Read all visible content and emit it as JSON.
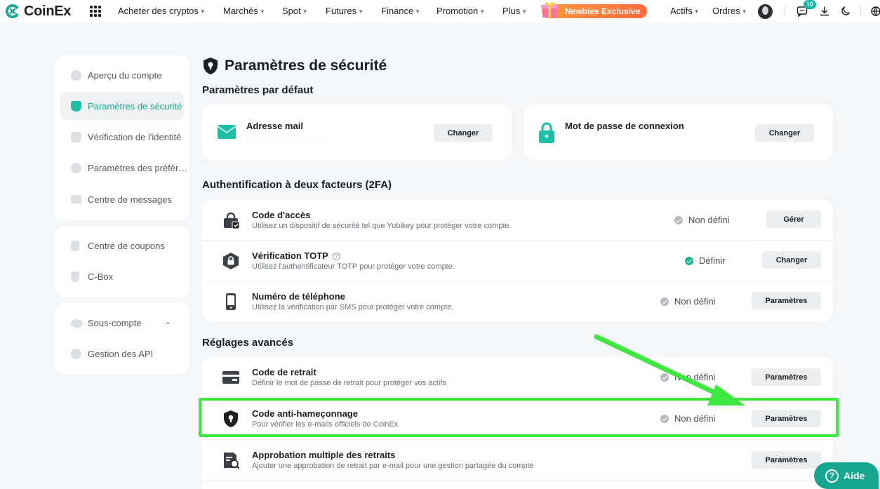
{
  "brand": {
    "name": "CoinEx",
    "accent": "#14a68f"
  },
  "nav": {
    "items": [
      "Acheter des cryptos",
      "Marchés",
      "Spot",
      "Futures",
      "Finance",
      "Promotion",
      "Plus"
    ],
    "promo_label": "Newbies Exclusive",
    "right_items": [
      "Actifs",
      "Ordres"
    ],
    "notification_count": "10"
  },
  "sidebar": {
    "group1": [
      {
        "label": "Aperçu du compte",
        "icon": "pie-chart-icon"
      },
      {
        "label": "Paramètres de sécurité",
        "icon": "shield-icon",
        "active": true
      },
      {
        "label": "Vérification de l'identité",
        "icon": "id-check-icon"
      },
      {
        "label": "Paramètres des préfér…",
        "icon": "preferences-icon"
      },
      {
        "label": "Centre de messages",
        "icon": "message-icon"
      }
    ],
    "group2": [
      {
        "label": "Centre de coupons",
        "icon": "coupon-icon"
      },
      {
        "label": "C-Box",
        "icon": "cbox-icon"
      }
    ],
    "group3": [
      {
        "label": "Sous-compte",
        "icon": "subaccount-icon"
      },
      {
        "label": "Gestion des API",
        "icon": "api-icon"
      }
    ]
  },
  "page": {
    "title": "Paramètres de sécurité",
    "default_section": {
      "title": "Paramètres par défaut",
      "email": {
        "title": "Adresse mail",
        "masked_value": "· · · · · · · · · · ·  · ·",
        "button": "Changer"
      },
      "password": {
        "title": "Mot de passe de connexion",
        "button": "Changer"
      }
    },
    "twofa_section": {
      "title": "Authentification à deux facteurs (2FA)",
      "rows": [
        {
          "title": "Code d'accès",
          "desc": "Utilisez un dispositif de sécurité tel que Yubikey pour protéger votre compte.",
          "status": "Non défini",
          "button": "Gérer"
        },
        {
          "title": "Vérification TOTP",
          "desc": "Utilisez l'authentificateur TOTP pour protéger votre compte.",
          "status": "Définir",
          "button": "Changer",
          "help": "?"
        },
        {
          "title": "Numéro de téléphone",
          "desc": "Utilisez la vérification par SMS pour protéger votre compte.",
          "status": "Non défini",
          "button": "Paramètres"
        }
      ]
    },
    "advanced_section": {
      "title": "Réglages avancés",
      "rows": [
        {
          "title": "Code de retrait",
          "desc": "Définir le mot de passe de retrait pour protéger vos actifs",
          "status": "Non défini",
          "button": "Paramètres"
        },
        {
          "title": "Code anti-hameçonnage",
          "desc": "Pour vérifier les e-mails officiels de CoinEx",
          "status": "Non défini",
          "button": "Paramètres"
        },
        {
          "title": "Approbation multiple des retraits",
          "desc": "Ajouter une approbation de retrait par e-mail pour une gestion partagée du compte",
          "button": "Paramètres"
        }
      ]
    }
  },
  "help_button": {
    "icon": "?",
    "label": "Aide"
  },
  "annotation": {
    "highlight_color": "#3ee83e"
  }
}
